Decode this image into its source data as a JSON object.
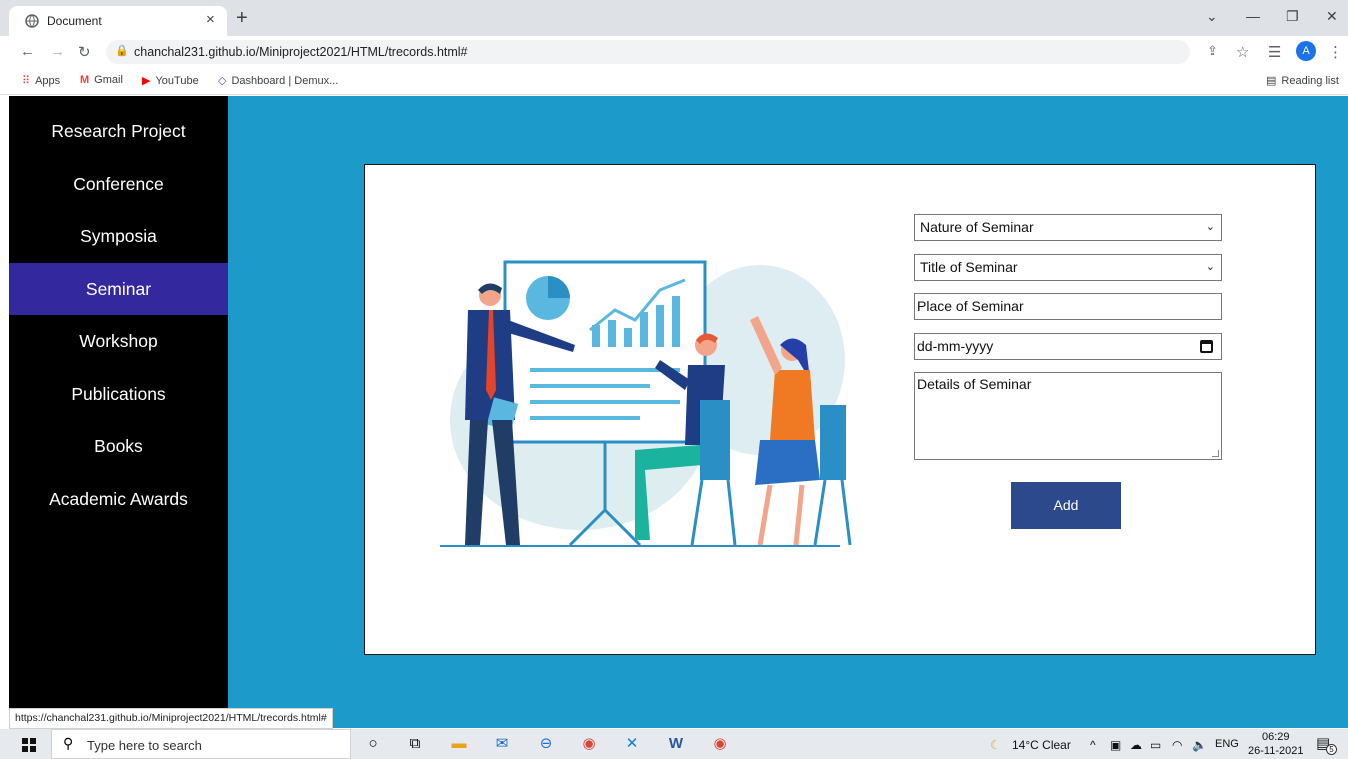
{
  "browser": {
    "tab_title": "Document",
    "tab_close": "×",
    "new_tab": "+",
    "url": "chanchal231.github.io/Miniproject2021/HTML/trecords.html#",
    "bookmarks": [
      "Apps",
      "Gmail",
      "YouTube",
      "Dashboard | Demux..."
    ],
    "reading_list": "Reading list",
    "profile_initial": "A"
  },
  "sidebar": {
    "items": [
      {
        "label": "Research Project",
        "active": false
      },
      {
        "label": "Conference",
        "active": false
      },
      {
        "label": "Symposia",
        "active": false
      },
      {
        "label": "Seminar",
        "active": true
      },
      {
        "label": "Workshop",
        "active": false
      },
      {
        "label": "Publications",
        "active": false
      },
      {
        "label": "Books",
        "active": false
      },
      {
        "label": "Academic Awards",
        "active": false
      }
    ]
  },
  "form": {
    "nature_select": "Nature of Seminar",
    "title_select": "Title of Seminar",
    "place_placeholder": "Place of Seminar",
    "date_placeholder": "dd-mm-yyyy",
    "details_placeholder": "Details of Seminar",
    "add_label": "Add"
  },
  "status_url": "https://chanchal231.github.io/Miniproject2021/HTML/trecords.html#",
  "taskbar": {
    "search_placeholder": "Type here to search",
    "weather": "14°C  Clear",
    "language": "ENG",
    "time": "06:29",
    "date": "26-11-2021",
    "notification_count": "5"
  },
  "colors": {
    "page_bg": "#1c9ac9",
    "sidebar_bg": "#000000",
    "active_item": "#33289d",
    "add_button": "#2c4a8b"
  }
}
